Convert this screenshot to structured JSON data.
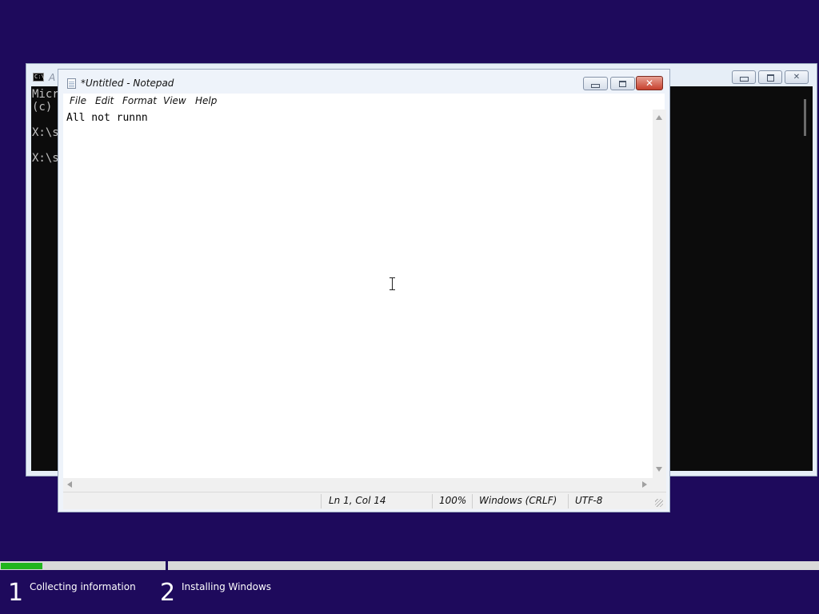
{
  "cmd": {
    "title_fragment": "A",
    "lines": [
      "Micr",
      "(c)",
      "",
      "X:\\s",
      "",
      "X:\\s"
    ]
  },
  "notepad": {
    "title": "*Untitled - Notepad",
    "menu": [
      "File",
      "Edit",
      "Format",
      "View",
      "Help"
    ],
    "content": "All not runnn",
    "status": {
      "position": "Ln 1, Col 14",
      "zoom": "100%",
      "line_ending": "Windows (CRLF)",
      "encoding": "UTF-8"
    }
  },
  "setup": {
    "progress_percent": 25,
    "steps": [
      {
        "number": "1",
        "label": "Collecting information"
      },
      {
        "number": "2",
        "label": "Installing Windows"
      }
    ]
  },
  "colors": {
    "desktop": "#1e0a5c",
    "progress_fill": "#21b51e",
    "close_button": "#c6402d"
  }
}
